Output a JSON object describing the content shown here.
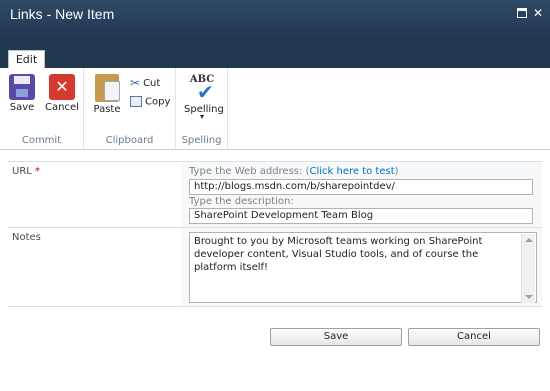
{
  "window": {
    "title": "Links - New Item"
  },
  "tabs": [
    {
      "label": "Edit"
    }
  ],
  "ribbon": {
    "commit": {
      "group_label": "Commit",
      "save": "Save",
      "cancel": "Cancel"
    },
    "clipboard": {
      "group_label": "Clipboard",
      "paste": "Paste",
      "cut": "Cut",
      "copy": "Copy"
    },
    "spelling": {
      "group_label": "Spelling",
      "spelling": "Spelling",
      "abc": "ABC"
    }
  },
  "form": {
    "url": {
      "label": "URL",
      "required_marker": "*",
      "address_hint": "Type the Web address: (",
      "test_link": "Click here to test",
      "address_hint_end": ")",
      "address_value": "http://blogs.msdn.com/b/sharepointdev/",
      "description_hint": "Type the description:",
      "description_value": "SharePoint Development Team Blog"
    },
    "notes": {
      "label": "Notes",
      "value": "Brought to you by Microsoft teams working on SharePoint developer content, Visual Studio tools, and of course the platform itself!"
    }
  },
  "footer": {
    "save": "Save",
    "cancel": "Cancel"
  },
  "colors": {
    "titlebar": "#1f3550",
    "link": "#0072bc",
    "required": "#cc0000"
  },
  "icons": [
    "save-icon",
    "cancel-icon",
    "paste-icon",
    "cut-icon",
    "copy-icon",
    "spelling-icon",
    "maximize-icon",
    "close-icon"
  ]
}
